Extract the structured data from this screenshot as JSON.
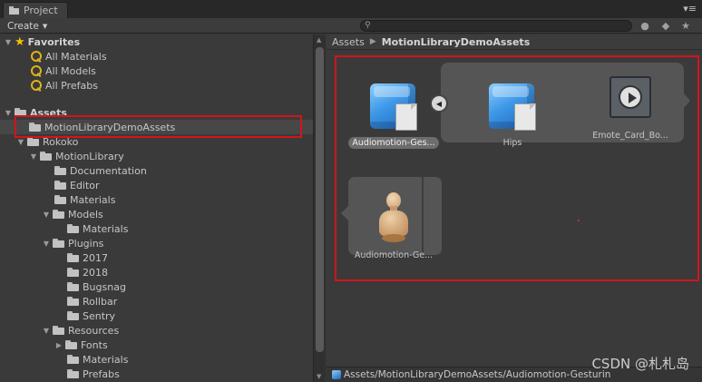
{
  "window": {
    "tab_title": "Project",
    "tab_menu_icon": "menu-icon"
  },
  "toolbar": {
    "create_label": "Create",
    "search_placeholder": "",
    "icons": [
      "filter-by-type-icon",
      "filter-by-label-icon",
      "favorite-icon"
    ]
  },
  "tree": {
    "favorites_label": "Favorites",
    "favorites": [
      {
        "label": "All Materials"
      },
      {
        "label": "All Models"
      },
      {
        "label": "All Prefabs"
      }
    ],
    "assets_label": "Assets",
    "items": [
      {
        "label": "MotionLibraryDemoAssets",
        "selected": true
      },
      {
        "label": "Rokoko"
      },
      {
        "label": "MotionLibrary"
      },
      {
        "label": "Documentation"
      },
      {
        "label": "Editor"
      },
      {
        "label": "Materials"
      },
      {
        "label": "Models"
      },
      {
        "label": "Materials"
      },
      {
        "label": "Plugins"
      },
      {
        "label": "2017"
      },
      {
        "label": "2018"
      },
      {
        "label": "Bugsnag"
      },
      {
        "label": "Rollbar"
      },
      {
        "label": "Sentry"
      },
      {
        "label": "Resources"
      },
      {
        "label": "Fonts"
      },
      {
        "label": "Materials"
      },
      {
        "label": "Prefabs"
      }
    ]
  },
  "breadcrumb": {
    "root": "Assets",
    "current": "MotionLibraryDemoAssets"
  },
  "assets": [
    {
      "label": "Audiomotion-Ges...",
      "icon": "prefab-icon",
      "selected": true
    },
    {
      "label": "Hips",
      "icon": "prefab-icon"
    },
    {
      "label": "Emote_Card_Bo...",
      "icon": "animation-clip-icon"
    },
    {
      "label": "Audiomotion-Ge...",
      "icon": "avatar-icon"
    }
  ],
  "status_path": "Assets/MotionLibraryDemoAssets/Audiomotion-Gesturin",
  "watermark": "CSDN @札札岛",
  "colors": {
    "highlight_box": "#d3141a",
    "background": "#383838"
  }
}
